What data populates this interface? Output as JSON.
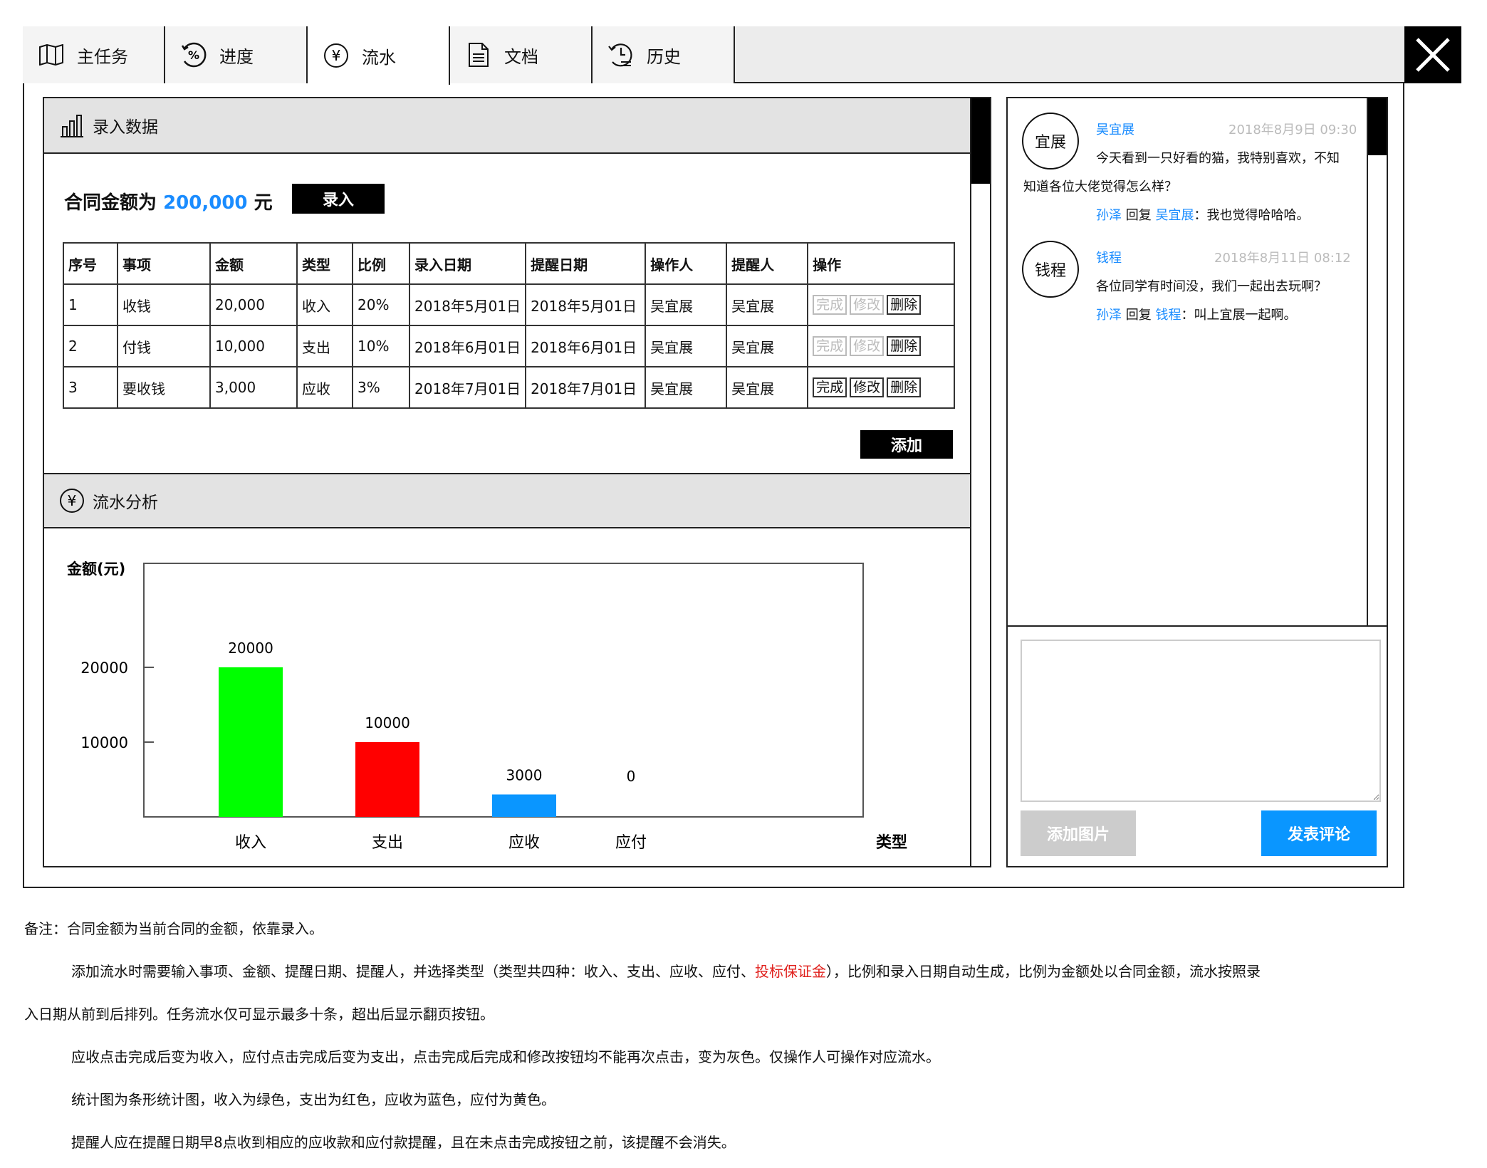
{
  "tabs": [
    {
      "label": "主任务",
      "icon": "map-icon"
    },
    {
      "label": "进度",
      "icon": "percent-icon"
    },
    {
      "label": "流水",
      "icon": "yen-icon"
    },
    {
      "label": "文档",
      "icon": "document-icon"
    },
    {
      "label": "历史",
      "icon": "history-icon"
    }
  ],
  "active_tab": "流水",
  "entry_section": {
    "title": "录入数据",
    "amount_prefix": "合同金额为",
    "amount_value": "200,000",
    "amount_unit": "元",
    "enter_button": "录入",
    "add_button": "添加",
    "columns": [
      "序号",
      "事项",
      "金额",
      "类型",
      "比例",
      "录入日期",
      "提醒日期",
      "操作人",
      "提醒人",
      "操作"
    ],
    "rows": [
      {
        "no": "1",
        "item": "收钱",
        "amount": "20,000",
        "type": "收入",
        "ratio": "20%",
        "entry_date": "2018年5月01日",
        "remind_date": "2018年5月01日",
        "operator": "吴宜展",
        "reminder": "吴宜展",
        "done_enabled": false,
        "edit_enabled": false
      },
      {
        "no": "2",
        "item": "付钱",
        "amount": "10,000",
        "type": "支出",
        "ratio": "10%",
        "entry_date": "2018年6月01日",
        "remind_date": "2018年6月01日",
        "operator": "吴宜展",
        "reminder": "吴宜展",
        "done_enabled": false,
        "edit_enabled": false
      },
      {
        "no": "3",
        "item": "要收钱",
        "amount": "3,000",
        "type": "应收",
        "ratio": "3%",
        "entry_date": "2018年7月01日",
        "remind_date": "2018年7月01日",
        "operator": "吴宜展",
        "reminder": "吴宜展",
        "done_enabled": true,
        "edit_enabled": true
      }
    ],
    "action_labels": {
      "done": "完成",
      "edit": "修改",
      "delete": "删除"
    }
  },
  "analysis_section": {
    "title": "流水分析"
  },
  "chart_data": {
    "type": "bar",
    "categories": [
      "收入",
      "支出",
      "应收",
      "应付"
    ],
    "values": [
      20000,
      10000,
      3000,
      0
    ],
    "colors": [
      "#00ff00",
      "#ff0000",
      "#0a96ff",
      "#ffd700"
    ],
    "ylabel": "金额(元)",
    "xlabel": "类型",
    "yticks": [
      10000,
      20000
    ],
    "ylim": [
      0,
      25000
    ],
    "grid": false
  },
  "comments": [
    {
      "avatar": "宜展",
      "name": "吴宜展",
      "time": "2018年8月9日 09:30",
      "text_line1": "今天看到一只好看的猫，我特别喜欢，不知",
      "text_line2": "知道各位大佬觉得怎么样？",
      "reply": {
        "from": "孙泽",
        "verb": "回复",
        "to": "吴宜展",
        "text": "：我也觉得哈哈哈。"
      }
    },
    {
      "avatar": "钱程",
      "name": "钱程",
      "time": "2018年8月11日 08:12",
      "text_line1": "各位同学有时间没，我们一起出去玩啊？",
      "text_line2": "",
      "reply": {
        "from": "孙泽",
        "verb": "回复",
        "to": "钱程",
        "text": "：叫上宜展一起啊。"
      }
    }
  ],
  "comment_actions": {
    "add_image": "添加图片",
    "post": "发表评论"
  },
  "notes": {
    "line1": "备注：合同金额为当前合同的金额，依靠录入。",
    "line2a": "添加流水时需要输入事项、金额、提醒日期、提醒人，并选择类型（类型共四种：收入、支出、应收、应付、",
    "line2b": "投标保证金",
    "line2c": "），比例和录入日期自动生成，比例为金额处以合同金额，流水按照录",
    "line3": "入日期从前到后排列。任务流水仅可显示最多十条，超出后显示翻页按钮。",
    "line4": "应收点击完成后变为收入，应付点击完成后变为支出，点击完成后完成和修改按钮均不能再次点击，变为灰色。仅操作人可操作对应流水。",
    "line5": "统计图为条形统计图，收入为绿色，支出为红色，应收为蓝色，应付为黄色。",
    "line6": "提醒人应在提醒日期早8点收到相应的应收款和应付款提醒，且在未点击完成按钮之前，该提醒不会消失。"
  }
}
